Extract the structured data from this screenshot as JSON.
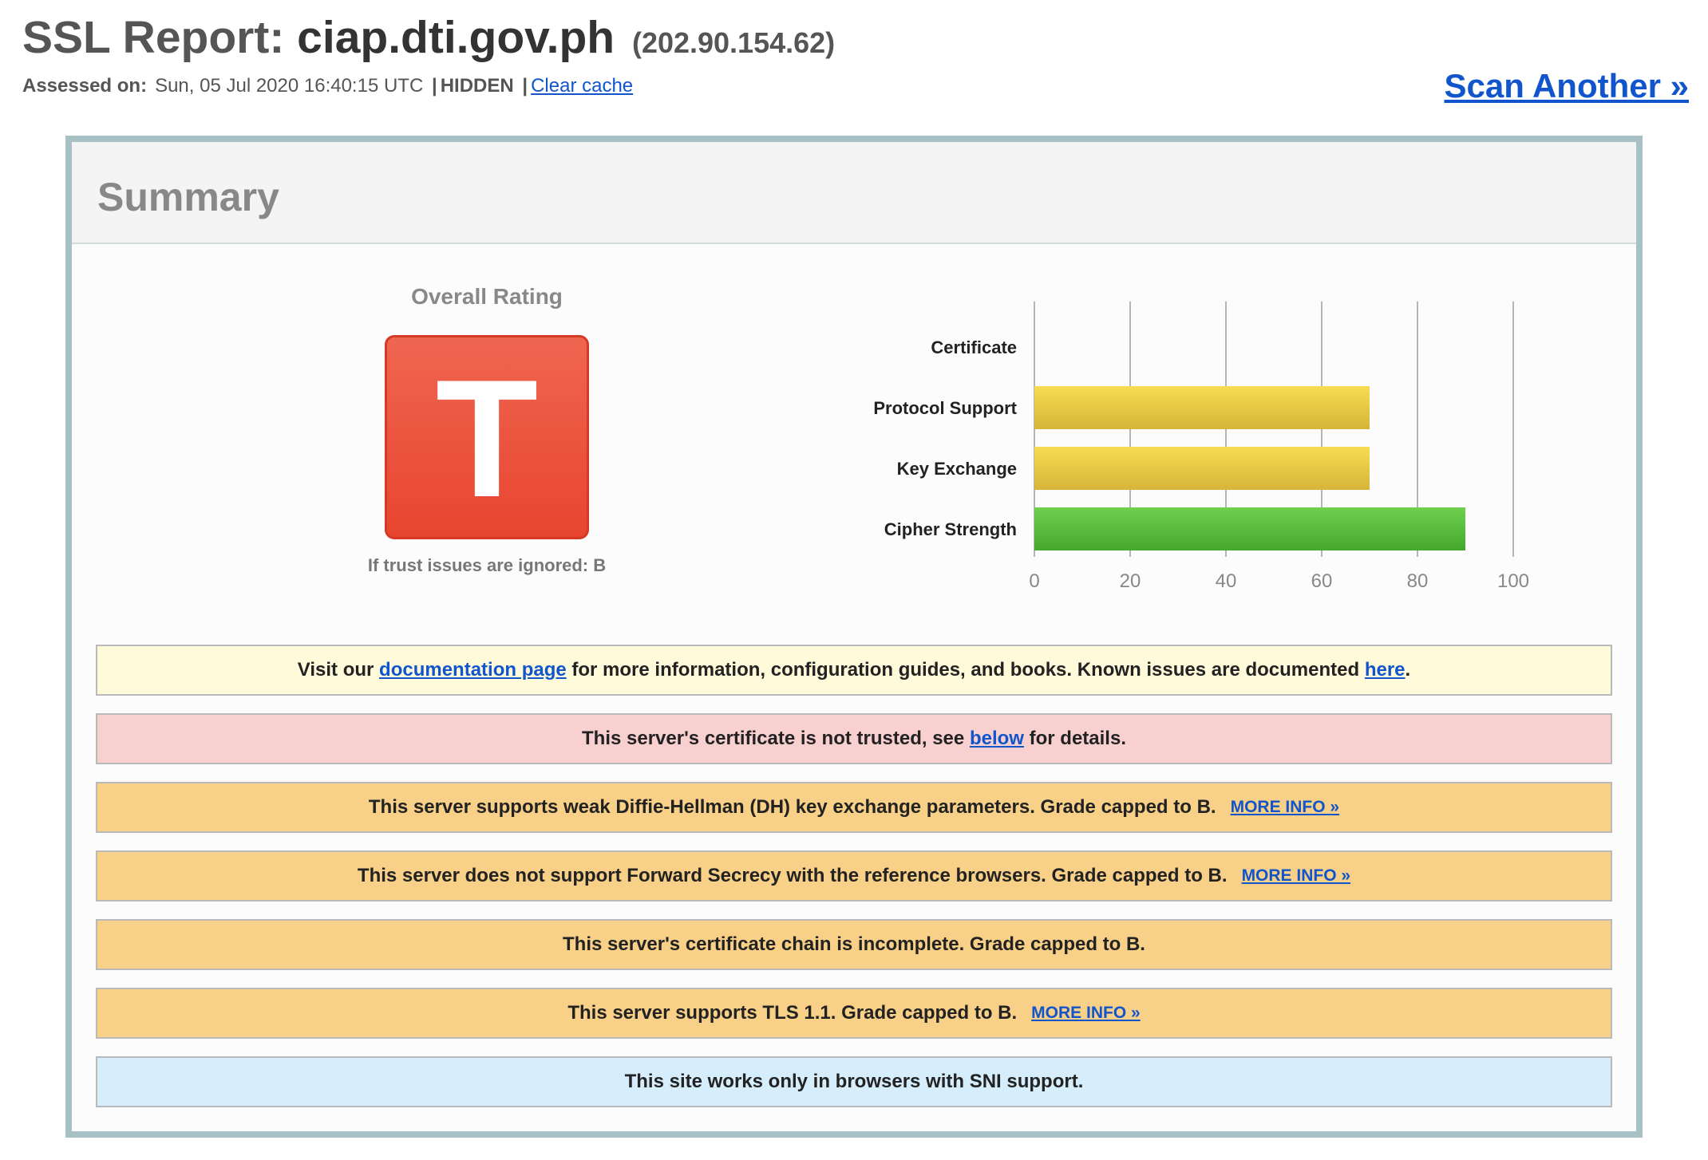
{
  "header": {
    "title_prefix": "SSL Report:",
    "host": "ciap.dti.gov.ph",
    "ip": "(202.90.154.62)",
    "assessed_label": "Assessed on:",
    "assessed_value": "Sun, 05 Jul 2020 16:40:15 UTC",
    "separator": "|",
    "hidden_label": "HIDDEN",
    "clear_cache": "Clear cache",
    "scan_another": "Scan Another »"
  },
  "summary": {
    "title": "Summary",
    "overall_label": "Overall Rating",
    "grade": "T",
    "grade_color": "#e84c36",
    "trust_ignored": "If trust issues are ignored: B"
  },
  "chart_data": {
    "type": "bar",
    "orientation": "horizontal",
    "categories": [
      "Certificate",
      "Protocol Support",
      "Key Exchange",
      "Cipher Strength"
    ],
    "values": [
      0,
      70,
      70,
      90
    ],
    "bar_colors": [
      "#f0c93a",
      "#f0c93a",
      "#f0c93a",
      "#57bd3b"
    ],
    "xlim": [
      0,
      100
    ],
    "xticks": [
      "0",
      "20",
      "40",
      "60",
      "80",
      "100"
    ],
    "grid": true
  },
  "notices": [
    {
      "type": "info",
      "pre": "Visit our",
      "link1": "documentation page",
      "mid": "for more information, configuration guides, and books. Known issues are documented",
      "link2": "here",
      "post": "."
    },
    {
      "type": "error",
      "pre": "This server's certificate is not trusted, see",
      "link": "below",
      "post": "for details."
    },
    {
      "type": "warn",
      "text": "This server supports weak Diffie-Hellman (DH) key exchange parameters. Grade capped to B.",
      "more": "MORE INFO »"
    },
    {
      "type": "warn",
      "text": "This server does not support Forward Secrecy with the reference browsers. Grade capped to B.",
      "more": "MORE INFO »"
    },
    {
      "type": "warn",
      "text": "This server's certificate chain is incomplete. Grade capped to B."
    },
    {
      "type": "warn",
      "text": "This server supports TLS 1.1. Grade capped to B.",
      "more": "MORE INFO »"
    },
    {
      "type": "note",
      "text": "This site works only in browsers with SNI support."
    }
  ]
}
